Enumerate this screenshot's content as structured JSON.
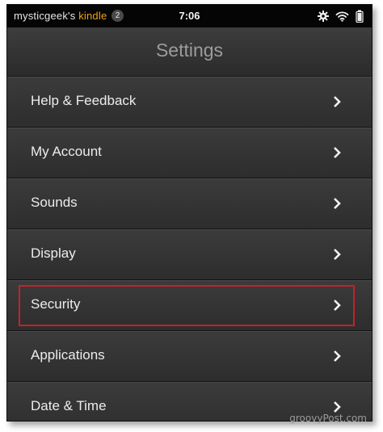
{
  "status_bar": {
    "owner_name": "mysticgeek's",
    "device_name": "kindle",
    "notification_count": "2",
    "time": "7:06",
    "icons": [
      "gear-icon",
      "wifi-icon",
      "battery-icon"
    ]
  },
  "header": {
    "title": "Settings"
  },
  "menu": {
    "items": [
      {
        "label": "Help & Feedback",
        "icon": "chevron-right-icon"
      },
      {
        "label": "My Account",
        "icon": "chevron-right-icon"
      },
      {
        "label": "Sounds",
        "icon": "chevron-right-icon"
      },
      {
        "label": "Display",
        "icon": "chevron-right-icon"
      },
      {
        "label": "Security",
        "icon": "chevron-right-icon",
        "highlighted": true
      },
      {
        "label": "Applications",
        "icon": "chevron-right-icon"
      },
      {
        "label": "Date & Time",
        "icon": "chevron-right-icon"
      }
    ]
  },
  "colors": {
    "accent": "#f0a21b",
    "highlight_border": "#c8202a",
    "background": "#2f2f2f"
  },
  "watermark": "groovyPost.com"
}
